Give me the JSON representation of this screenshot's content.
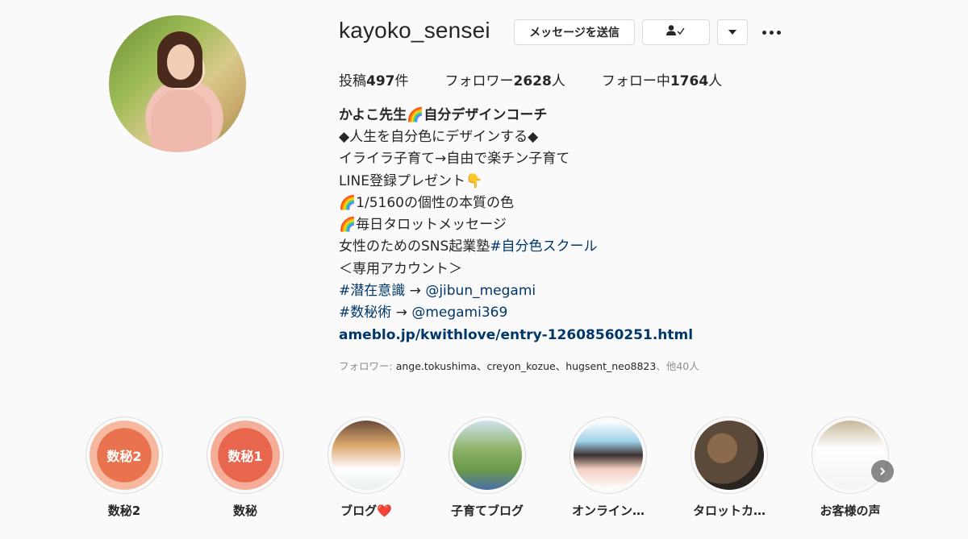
{
  "profile": {
    "username": "kayoko_sensei",
    "message_button": "メッセージを送信",
    "stats": {
      "posts_prefix": "投稿",
      "posts_count": "497",
      "posts_suffix": "件",
      "followers_prefix": "フォロワー",
      "followers_count": "2628",
      "followers_suffix": "人",
      "following_prefix": "フォロー中",
      "following_count": "1764",
      "following_suffix": "人"
    },
    "bio": {
      "name": "かよこ先生🌈自分デザインコーチ",
      "line1": "◆人生を自分色にデザインする◆",
      "line2": "イライラ子育て→自由で楽チン子育て",
      "line3": "LINE登録プレゼント👇",
      "line4": "🌈1/5160の個性の本質の色",
      "line5": "🌈毎日タロットメッセージ",
      "line6_text": "女性のためのSNS起業塾",
      "line6_tag": "#自分色スクール",
      "line7": "＜専用アカウント＞",
      "line8_tag": "#潜在意識",
      "line8_arrow": " → ",
      "line8_mention": "@jibun_megami",
      "line9_tag": "#数秘術",
      "line9_arrow": " → ",
      "line9_mention": "@megami369",
      "link": "ameblo.jp/kwithlove/entry-12608560251.html"
    },
    "followed_by": {
      "prefix": "フォロワー: ",
      "names": "ange.tokushima、creyon_kozue、hugsent_neo8823",
      "suffix": "、他40人"
    }
  },
  "highlights": [
    {
      "label": "数秘2",
      "badge": "数秘2",
      "color": "#e9734e"
    },
    {
      "label": "数秘",
      "badge": "数秘1",
      "color": "#e9664e"
    },
    {
      "label": "ブログ❤️",
      "badge": "",
      "color": "#d9a86b"
    },
    {
      "label": "子育てブログ",
      "badge": "",
      "color": "#8fb46a"
    },
    {
      "label": "オンライン…",
      "badge": "",
      "color": "#9fd2e8"
    },
    {
      "label": "タロットカ…",
      "badge": "",
      "color": "#5b4a3a"
    },
    {
      "label": "お客様の声",
      "badge": "",
      "color": "#e9e4d6"
    }
  ],
  "icons": {
    "following": "person-check-icon",
    "dropdown": "chevron-down-icon",
    "more": "more-dots-icon",
    "next": "chevron-right-icon"
  }
}
